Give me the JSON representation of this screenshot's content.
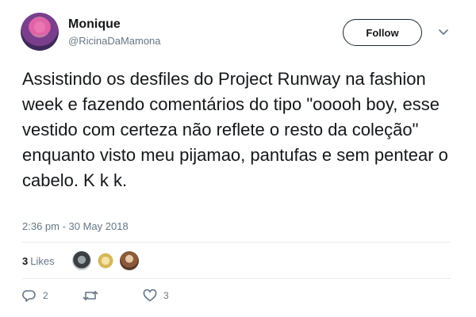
{
  "tweet": {
    "display_name": "Monique",
    "handle": "@RicinaDaMamona",
    "follow_label": "Follow",
    "text": "Assistindo os desfiles do Project Runway na fashion week e fazendo comentários do tipo \"ooooh boy, esse vestido com certeza não reflete o resto da coleção\" enquanto visto meu pijamao, pantufas e sem pentear o cabelo. K k k.",
    "timestamp": "2:36 pm - 30 May 2018"
  },
  "likes": {
    "count": "3",
    "label": "Likes"
  },
  "actions": {
    "replies": "2",
    "retweets": "",
    "likes": "3"
  },
  "colors": {
    "text": "#14171a",
    "secondary": "#657786",
    "divider": "#e6ecf0"
  },
  "icons": [
    "chevron-down-icon",
    "reply-icon",
    "retweet-icon",
    "heart-icon"
  ]
}
